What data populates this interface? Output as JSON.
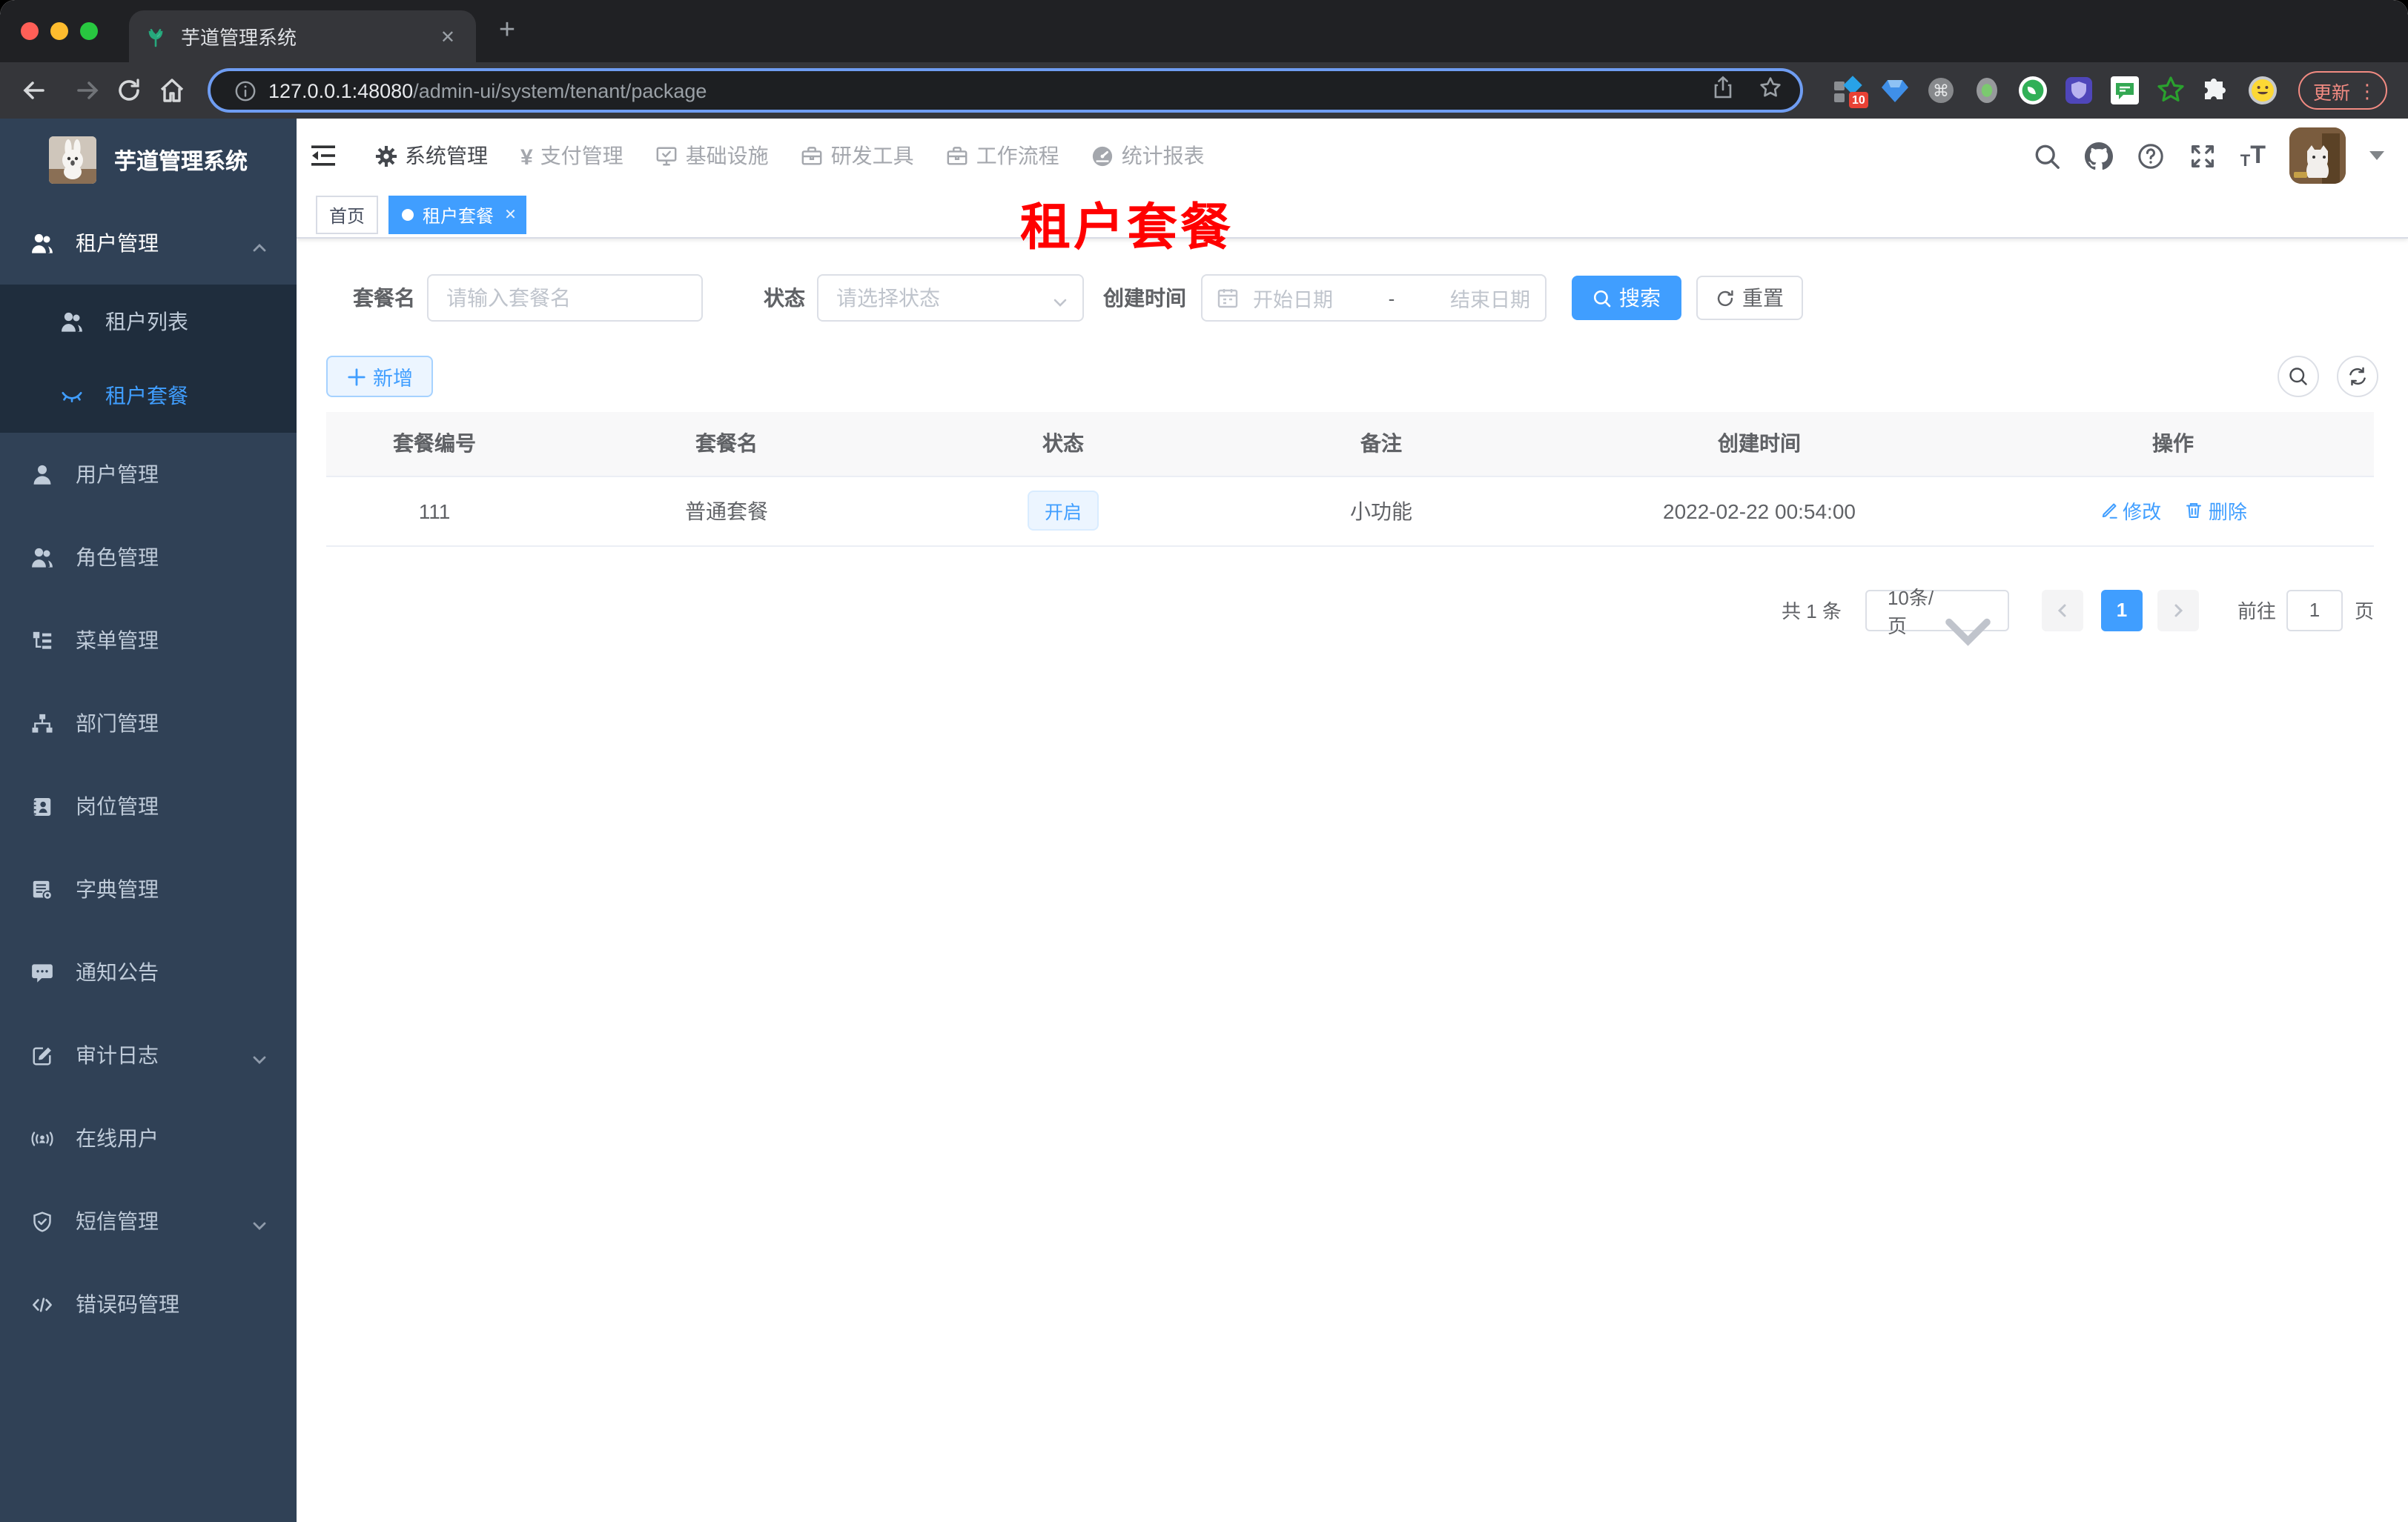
{
  "colors": {
    "accent": "#409eff",
    "page_title_red": "#ff0000",
    "sidebar_bg": "#304156",
    "submenu_bg": "#1f2d3d"
  },
  "browser": {
    "tab_title": "芋道管理系统",
    "close_tab_glyph": "✕",
    "new_tab_glyph": "+",
    "url_host": "127.0.0.1:48080",
    "url_path": "/admin-ui/system/tenant/package",
    "extension_badge": "10",
    "update_button": "更新",
    "kebab_glyph": "⋮"
  },
  "sidebar": {
    "title": "芋道管理系统",
    "items": [
      {
        "label": "租户管理",
        "icon": "peoples-icon",
        "children": [
          {
            "label": "租户列表",
            "icon": "peoples-icon"
          },
          {
            "label": "租户套餐",
            "icon": "eye-closed-icon"
          }
        ]
      },
      {
        "label": "用户管理",
        "icon": "user-icon"
      },
      {
        "label": "角色管理",
        "icon": "peoples-icon"
      },
      {
        "label": "菜单管理",
        "icon": "tree-table-icon"
      },
      {
        "label": "部门管理",
        "icon": "org-tree-icon"
      },
      {
        "label": "岗位管理",
        "icon": "post-icon"
      },
      {
        "label": "字典管理",
        "icon": "dict-icon"
      },
      {
        "label": "通知公告",
        "icon": "message-icon"
      },
      {
        "label": "审计日志",
        "icon": "log-icon"
      },
      {
        "label": "在线用户",
        "icon": "online-icon"
      },
      {
        "label": "短信管理",
        "icon": "shield-icon"
      },
      {
        "label": "错误码管理",
        "icon": "code-icon"
      }
    ]
  },
  "navbar": {
    "menu": [
      {
        "label": "系统管理"
      },
      {
        "label": "支付管理"
      },
      {
        "label": "基础设施"
      },
      {
        "label": "研发工具"
      },
      {
        "label": "工作流程"
      },
      {
        "label": "统计报表"
      }
    ]
  },
  "tags": {
    "home": "首页",
    "active": "租户套餐",
    "close_glyph": "✕"
  },
  "page_title": "租户套餐",
  "filters": {
    "name_label": "套餐名",
    "name_placeholder": "请输入套餐名",
    "status_label": "状态",
    "status_placeholder": "请选择状态",
    "date_label": "创建时间",
    "date_start_placeholder": "开始日期",
    "date_separator": "-",
    "date_end_placeholder": "结束日期"
  },
  "actions": {
    "search": "搜索",
    "reset": "重置",
    "add": "新增",
    "edit": "修改",
    "delete": "删除"
  },
  "table": {
    "columns": [
      "套餐编号",
      "套餐名",
      "状态",
      "备注",
      "创建时间",
      "操作"
    ],
    "rows": [
      {
        "id": "111",
        "name": "普通套餐",
        "status": "开启",
        "remark": "小功能",
        "created_at": "2022-02-22 00:54:00"
      }
    ]
  },
  "pagination": {
    "total": "共 1 条",
    "page_size": "10条/页",
    "current_page": "1",
    "goto_label": "前往",
    "goto_value": "1",
    "page_unit": "页"
  }
}
